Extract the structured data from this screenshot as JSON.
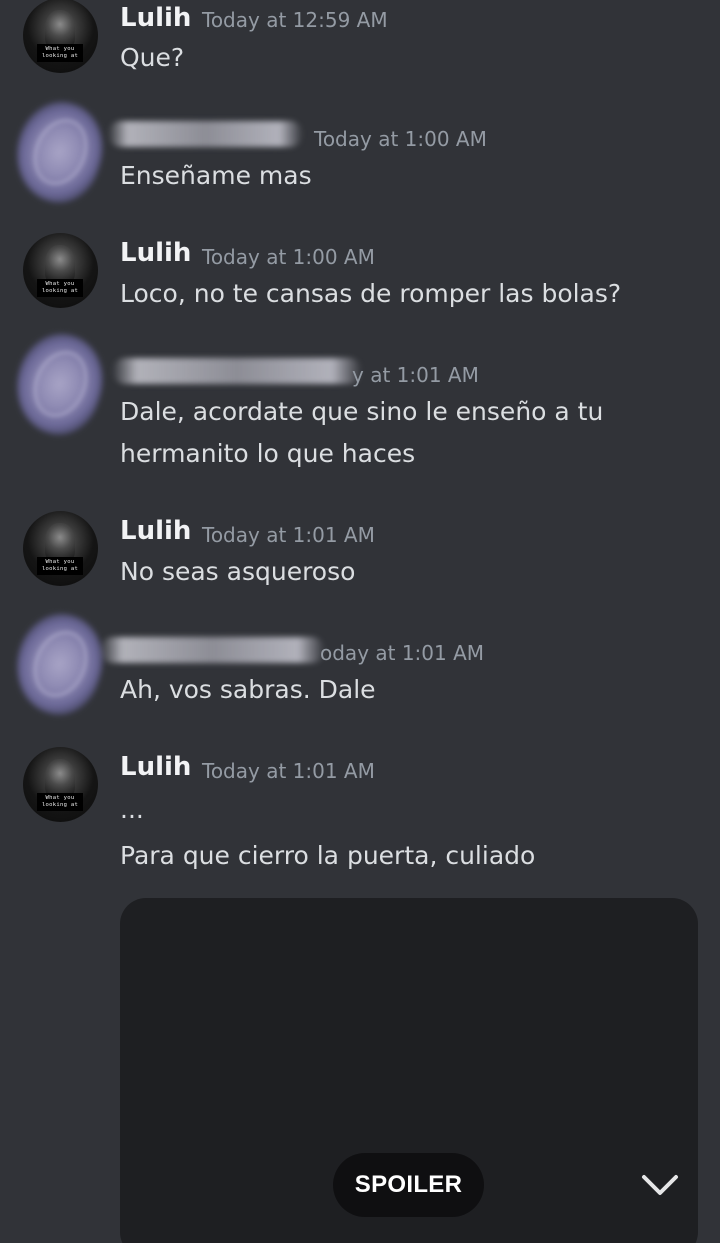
{
  "messages": [
    {
      "author": "Lulih",
      "time": "Today at 12:59 AM",
      "lines": [
        "Que?"
      ],
      "avatar": "lulih-avatar",
      "avatar_caption": "What you looking at"
    },
    {
      "author": "",
      "time": "Today at 1:00 AM",
      "lines": [
        "Enseñame mas"
      ],
      "avatar": "blurred-avatar"
    },
    {
      "author": "Lulih",
      "time": "Today at 1:00 AM",
      "lines": [
        "Loco, no te cansas de romper las bolas?"
      ],
      "avatar": "lulih-avatar",
      "avatar_caption": "What you looking at"
    },
    {
      "author": "",
      "time": "y at 1:01 AM",
      "lines": [
        "Dale, acordate que sino le enseño a tu",
        "hermanito lo que haces"
      ],
      "avatar": "blurred-avatar"
    },
    {
      "author": "Lulih",
      "time": "Today at 1:01 AM",
      "lines": [
        "No seas asqueroso"
      ],
      "avatar": "lulih-avatar",
      "avatar_caption": "What you looking at"
    },
    {
      "author": "",
      "time": "oday at 1:01 AM",
      "lines": [
        "Ah, vos sabras. Dale"
      ],
      "avatar": "blurred-avatar"
    },
    {
      "author": "Lulih",
      "time": "Today at 1:01 AM",
      "lines": [
        "...",
        "Para que cierro la puerta, culiado"
      ],
      "avatar": "lulih-avatar",
      "avatar_caption": "What you looking at"
    }
  ],
  "attachment": {
    "spoiler_label": "SPOILER",
    "jump_icon": "chevron-down-icon"
  },
  "colors": {
    "background": "#313338",
    "attachment_bg": "#1e1f22",
    "username": "#f2f3f5",
    "timestamp": "#949ba4",
    "text": "#dbdee1"
  }
}
